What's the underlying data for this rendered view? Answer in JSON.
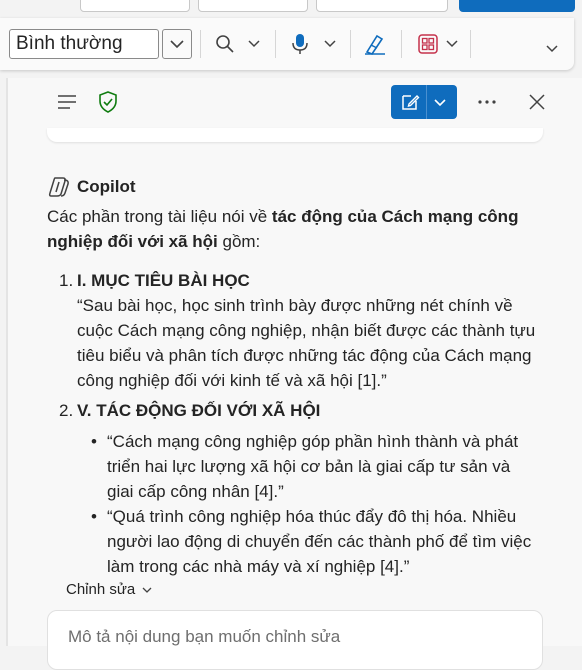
{
  "ribbon": {
    "style_value": "Bình thường"
  },
  "copilot": {
    "brand": "Copilot",
    "intro_prefix": "Các phần trong tài liệu nói về ",
    "intro_bold": "tác động của Cách mạng công nghiệp đối với xã hội",
    "intro_suffix": " gồm:",
    "items": [
      {
        "number": "1.",
        "title": "I. MỤC TIÊU BÀI HỌC",
        "lines": [
          "“Sau bài học, học sinh trình bày được những nét chính về",
          "cuộc Cách mạng công nghiệp, nhận biết được các thành tựu",
          "tiêu biểu và phân tích được những tác động của Cách mạng",
          "công nghiệp đối với kinh tế và xã hội [1].”"
        ]
      },
      {
        "number": "2.",
        "title": "V. TÁC ĐỘNG ĐỐI VỚI XÃ HỘI",
        "bullets": [
          {
            "lines": [
              "“Cách mạng công nghiệp góp phần hình thành và phát",
              "triển hai lực lượng xã hội cơ bản là giai cấp tư sản và",
              "giai cấp công nhân [4].”"
            ]
          },
          {
            "lines": [
              "“Quá trình công nghiệp hóa thúc đẩy đô thị hóa. Nhiều",
              "người lao động di chuyển đến các thành phố để tìm việc",
              "làm trong các nhà máy và xí nghiệp [4].”"
            ]
          }
        ]
      }
    ],
    "edit_label": "Chỉnh sửa",
    "input_placeholder": "Mô tả nội dung bạn muốn chỉnh sửa"
  },
  "colors": {
    "accent": "#0f6cbd",
    "shield": "#107c10"
  },
  "icons": [
    "hamburger-icon",
    "shield-check-icon",
    "compose-icon",
    "chevron-down-icon",
    "more-icon",
    "close-icon",
    "search-icon",
    "microphone-icon",
    "editor-icon",
    "addins-icon",
    "copilot-logo"
  ]
}
